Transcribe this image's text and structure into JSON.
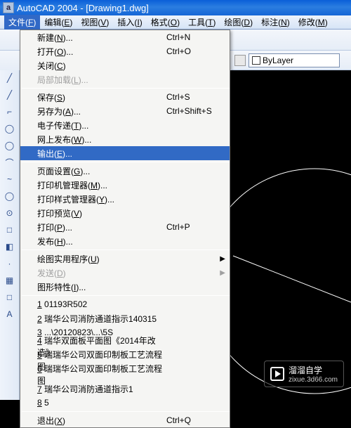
{
  "title": "AutoCAD 2004 - [Drawing1.dwg]",
  "app_icon_letter": "a",
  "menubar": [
    {
      "label": "文件",
      "key": "F",
      "open": true
    },
    {
      "label": "编辑",
      "key": "E"
    },
    {
      "label": "视图",
      "key": "V"
    },
    {
      "label": "插入",
      "key": "I"
    },
    {
      "label": "格式",
      "key": "O"
    },
    {
      "label": "工具",
      "key": "T"
    },
    {
      "label": "绘图",
      "key": "D"
    },
    {
      "label": "标注",
      "key": "N"
    },
    {
      "label": "修改",
      "key": "M"
    }
  ],
  "layer_label": "ByLayer",
  "file_menu": [
    {
      "type": "item",
      "label": "新建",
      "key": "N",
      "shortcut": "Ctrl+N",
      "ellipsis": true
    },
    {
      "type": "item",
      "label": "打开",
      "key": "O",
      "shortcut": "Ctrl+O",
      "ellipsis": true
    },
    {
      "type": "item",
      "label": "关闭",
      "key": "C"
    },
    {
      "type": "item",
      "label": "局部加载",
      "key": "L",
      "disabled": true,
      "ellipsis": true
    },
    {
      "type": "sep"
    },
    {
      "type": "item",
      "label": "保存",
      "key": "S",
      "shortcut": "Ctrl+S"
    },
    {
      "type": "item",
      "label": "另存为",
      "key": "A",
      "shortcut": "Ctrl+Shift+S",
      "ellipsis": true
    },
    {
      "type": "item",
      "label": "电子传递",
      "key": "T",
      "ellipsis": true
    },
    {
      "type": "item",
      "label": "网上发布",
      "key": "W",
      "ellipsis": true
    },
    {
      "type": "item",
      "label": "输出",
      "key": "E",
      "ellipsis": true,
      "highlight": true
    },
    {
      "type": "sep"
    },
    {
      "type": "item",
      "label": "页面设置",
      "key": "G",
      "ellipsis": true
    },
    {
      "type": "item",
      "label": "打印机管理器",
      "key": "M",
      "ellipsis": true
    },
    {
      "type": "item",
      "label": "打印样式管理器",
      "key": "Y",
      "ellipsis": true
    },
    {
      "type": "item",
      "label": "打印预览",
      "key": "V"
    },
    {
      "type": "item",
      "label": "打印",
      "key": "P",
      "shortcut": "Ctrl+P",
      "ellipsis": true
    },
    {
      "type": "item",
      "label": "发布",
      "key": "H",
      "ellipsis": true
    },
    {
      "type": "sep"
    },
    {
      "type": "item",
      "label": "绘图实用程序",
      "key": "U",
      "submenu": true
    },
    {
      "type": "item",
      "label": "发送",
      "key": "D",
      "disabled": true,
      "submenu": true
    },
    {
      "type": "item",
      "label": "图形特性",
      "key": "I",
      "ellipsis": true
    },
    {
      "type": "sep"
    },
    {
      "type": "item",
      "label": "1 01193R502",
      "key": "1"
    },
    {
      "type": "item",
      "label": "2 瑞华公司消防通道指示140315",
      "key": "2"
    },
    {
      "type": "item",
      "label": "3 ...\\20120823\\...\\5S",
      "key": "3"
    },
    {
      "type": "item",
      "label": "4 瑞华双面板平面图《2014年改造》",
      "key": "4"
    },
    {
      "type": "item",
      "label": "5 瑞瑞华公司双面印制板工艺流程图",
      "key": "5"
    },
    {
      "type": "item",
      "label": "6 瑞瑞华公司双面印制板工艺流程图",
      "key": "6"
    },
    {
      "type": "item",
      "label": "7 瑞华公司消防通道指示1",
      "key": "7"
    },
    {
      "type": "item",
      "label": "8 5",
      "key": "8"
    },
    {
      "type": "sep"
    },
    {
      "type": "item",
      "label": "退出",
      "key": "X",
      "shortcut": "Ctrl+Q"
    }
  ],
  "left_tools": [
    "╱",
    "╱",
    "⌐",
    "◯",
    "◯",
    "⌒",
    "~",
    "◯",
    "⊙",
    "□",
    "◧",
    "·",
    "▦",
    "□",
    "A"
  ],
  "watermark": {
    "name": "溜溜自学",
    "sub": "zixue.3d66.com"
  }
}
